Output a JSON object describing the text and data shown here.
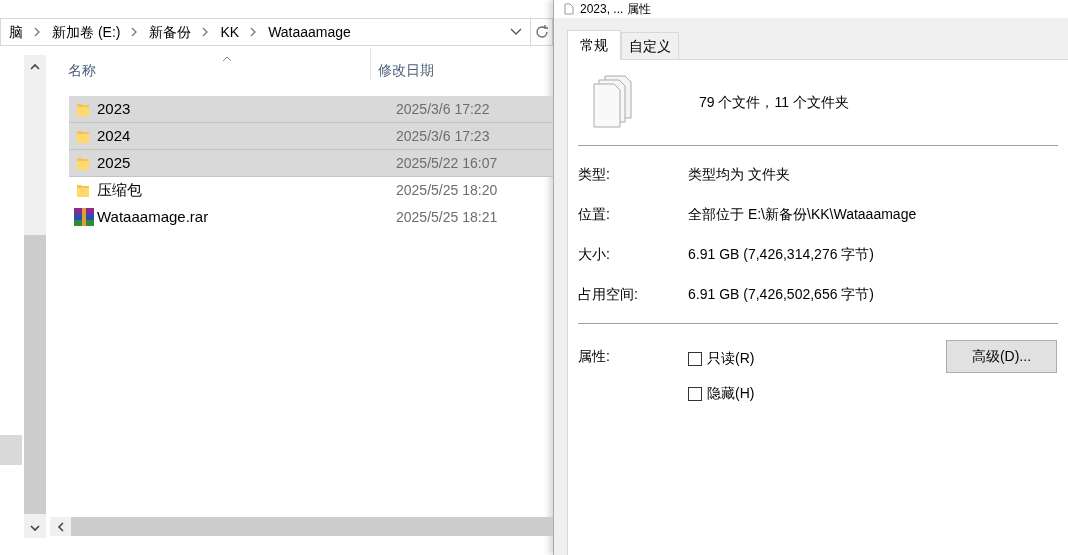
{
  "explorer": {
    "breadcrumb": [
      "脑",
      "新加卷 (E:)",
      "新备份",
      "KK",
      "Wataaamage"
    ],
    "columns": [
      "名称",
      "修改日期"
    ],
    "rows": [
      {
        "name": "2023",
        "date": "2025/3/6 17:22",
        "kind": "folder",
        "selected": true
      },
      {
        "name": "2024",
        "date": "2025/3/6 17:23",
        "kind": "folder",
        "selected": true
      },
      {
        "name": "2025",
        "date": "2025/5/22 16:07",
        "kind": "folder",
        "selected": true
      },
      {
        "name": "压缩包",
        "date": "2025/5/25 18:20",
        "kind": "folder",
        "selected": false
      },
      {
        "name": "Wataaamage.rar",
        "date": "2025/5/25 18:21",
        "kind": "archive",
        "selected": false
      }
    ]
  },
  "dialog": {
    "title": "2023, ... 属性",
    "tabs": [
      {
        "label": "常规",
        "selected": true
      },
      {
        "label": "自定义",
        "selected": false
      }
    ],
    "summary": "79 个文件，11 个文件夹",
    "details": [
      {
        "label": "类型:",
        "value": "类型均为 文件夹"
      },
      {
        "label": "位置:",
        "value": "全部位于 E:\\新备份\\KK\\Wataaamage"
      },
      {
        "label": "大小:",
        "value": "6.91 GB (7,426,314,276 字节)"
      },
      {
        "label": "占用空间:",
        "value": "6.91 GB (7,426,502,656 字节)"
      }
    ],
    "attributes_label": "属性:",
    "attributes": [
      {
        "label": "只读(R)",
        "checked": false
      },
      {
        "label": "隐藏(H)",
        "checked": false
      }
    ],
    "advanced_button": "高级(D)..."
  }
}
